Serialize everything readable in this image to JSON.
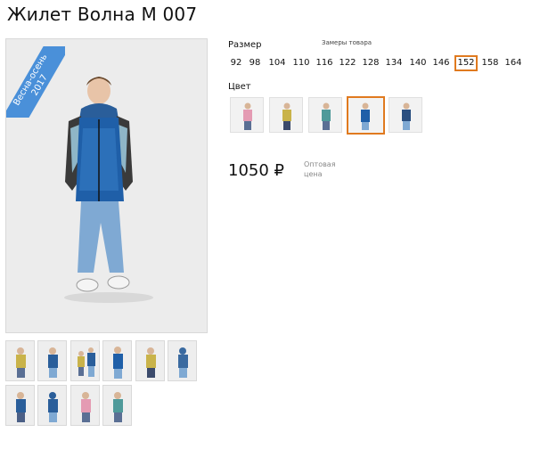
{
  "product": {
    "title": "Жилет Волна М 007",
    "badge_line1": "Весна-осень",
    "badge_line2": "2017"
  },
  "size": {
    "label": "Размер",
    "chart_link": "Замеры товара",
    "options": [
      "92",
      "98",
      "104",
      "110",
      "116",
      "122",
      "128",
      "134",
      "140",
      "146",
      "152",
      "158",
      "164"
    ],
    "selected": "152"
  },
  "color": {
    "label": "Цвет",
    "selected_index": 3,
    "swatches": [
      "pink",
      "yellow",
      "teal",
      "blue-pattern",
      "navy"
    ]
  },
  "price": {
    "value": "1050",
    "currency": "₽",
    "note": "Оптовая цена"
  },
  "colors": {
    "accent": "#e07a1f",
    "badge": "#4a90d9"
  },
  "thumbnails": {
    "count": 10
  }
}
